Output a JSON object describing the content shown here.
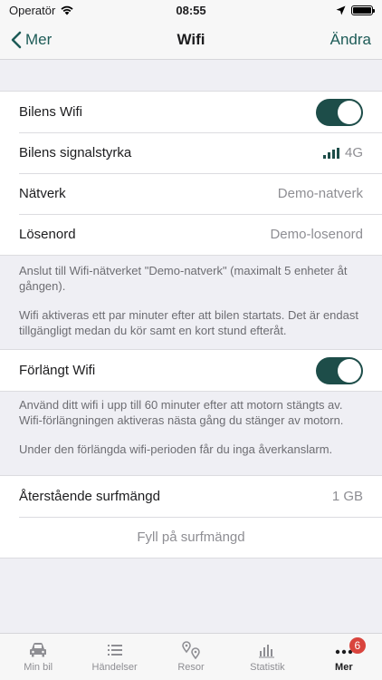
{
  "status_bar": {
    "carrier": "Operatör",
    "time": "08:55"
  },
  "nav": {
    "back_label": "Mer",
    "title": "Wifi",
    "edit_label": "Ändra"
  },
  "wifi_group": {
    "car_wifi_label": "Bilens Wifi",
    "car_wifi_on": true,
    "signal_label": "Bilens signalstyrka",
    "signal_value": "4G",
    "network_label": "Nätverk",
    "network_value": "Demo-natverk",
    "password_label": "Lösenord",
    "password_value": "Demo-losenord"
  },
  "wifi_footnote": {
    "p1": "Anslut till Wifi-nätverket \"Demo-natverk\" (maximalt 5 enheter åt gången).",
    "p2": "Wifi aktiveras ett par minuter efter att bilen startats. Det är endast tillgängligt medan du kör samt en kort stund efteråt."
  },
  "extended_group": {
    "label": "Förlängt Wifi",
    "on": true
  },
  "extended_footnote": {
    "p1": "Använd ditt wifi i upp till 60 minuter efter att motorn stängts av. Wifi-förlängningen aktiveras nästa gång du stänger av motorn.",
    "p2": "Under den förlängda wifi-perioden får du inga åverkanslarm."
  },
  "data_group": {
    "remaining_label": "Återstående surfmängd",
    "remaining_value": "1 GB",
    "refill_label": "Fyll på surfmängd"
  },
  "tabs": [
    {
      "label": "Min bil",
      "icon": "car-icon"
    },
    {
      "label": "Händelser",
      "icon": "list-icon"
    },
    {
      "label": "Resor",
      "icon": "map-pin-icon"
    },
    {
      "label": "Statistik",
      "icon": "bar-chart-icon"
    },
    {
      "label": "Mer",
      "icon": "more-icon",
      "badge": "6",
      "active": true
    }
  ],
  "colors": {
    "accent": "#1d5b57",
    "toggle_on": "#1d4d49",
    "badge": "#d9443d"
  }
}
